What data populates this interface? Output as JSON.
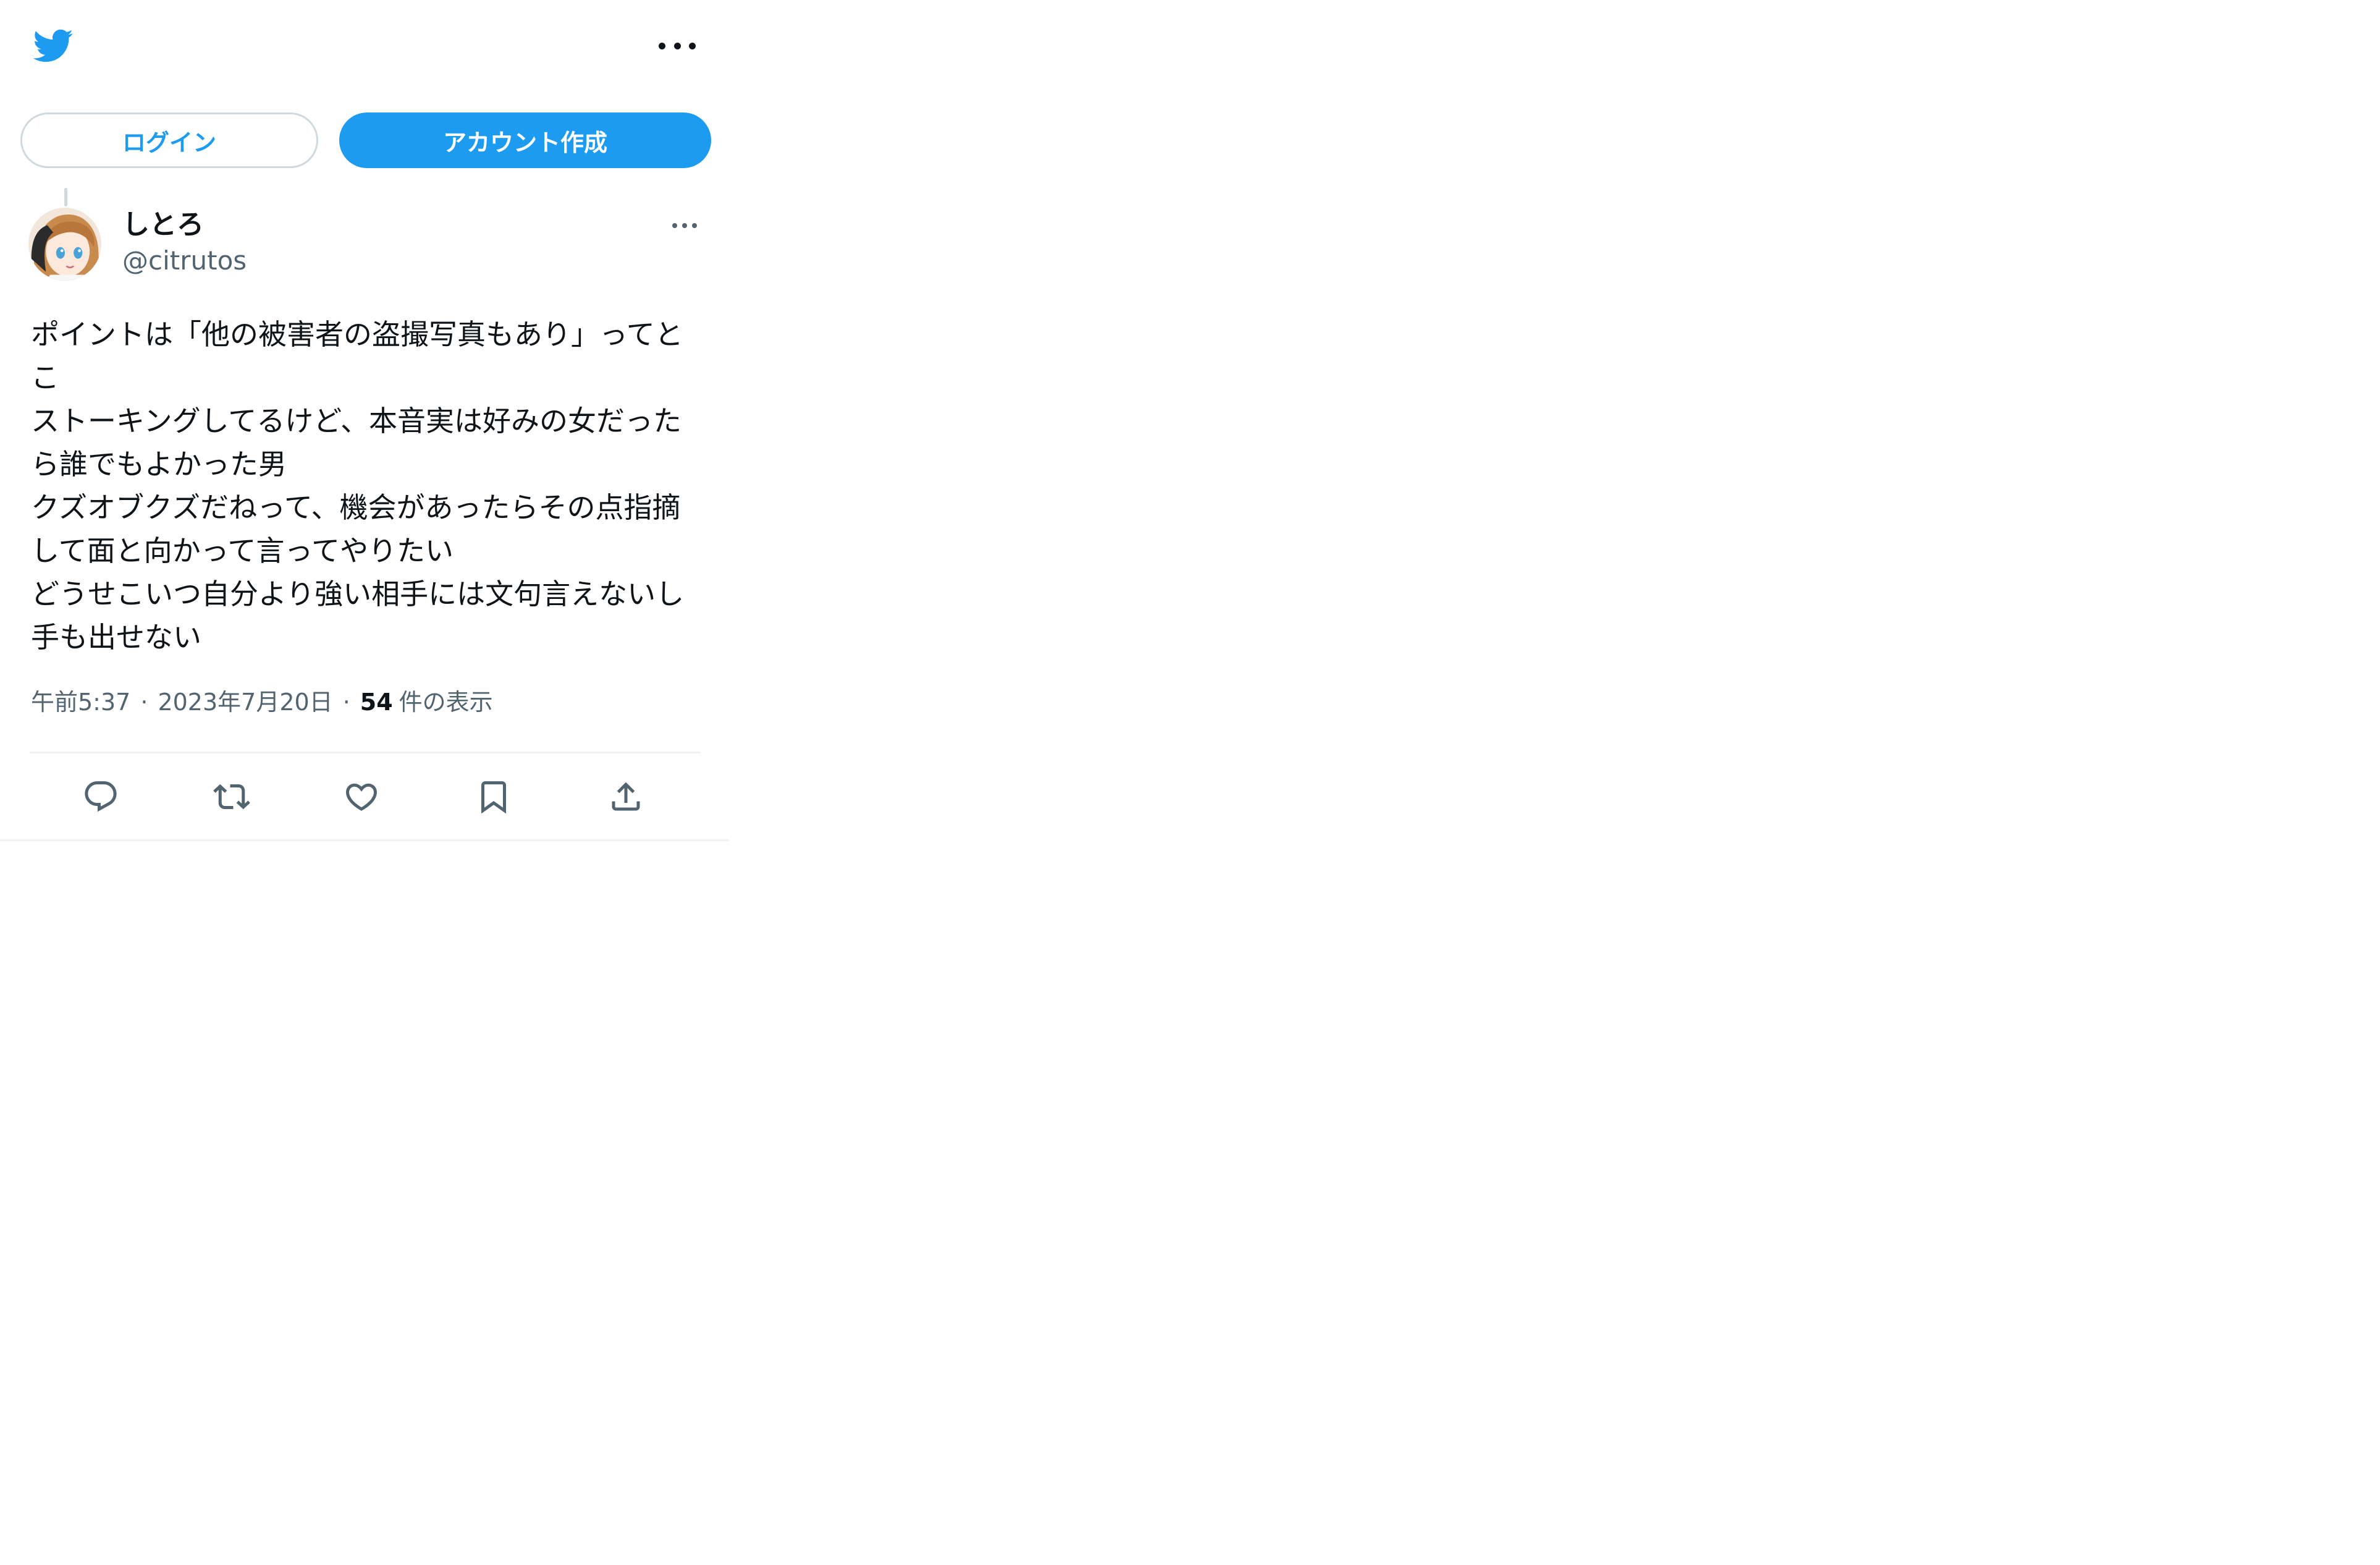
{
  "header": {
    "logo_icon": "twitter-bird-icon",
    "more_icon": "more-horizontal-icon"
  },
  "auth": {
    "login_label": "ログイン",
    "signup_label": "アカウント作成"
  },
  "tweet": {
    "author": {
      "name": "しとろ",
      "handle": "@citrutos",
      "avatar_icon": "avatar-anime-girl"
    },
    "text": "ポイントは「他の被害者の盗撮写真もあり」ってとこ\nストーキングしてるけど、本音実は好みの女だったら誰でもよかった男\nクズオブクズだねって、機会があったらその点指摘して面と向かって言ってやりたい\nどうせこいつ自分より強い相手には文句言えないし手も出せない",
    "time": "午前5:37",
    "separator": "·",
    "date": "2023年7月20日",
    "views_count": "54",
    "views_label": "件の表示"
  },
  "actions": [
    {
      "name": "reply",
      "icon": "reply-icon"
    },
    {
      "name": "retweet",
      "icon": "retweet-icon"
    },
    {
      "name": "like",
      "icon": "like-icon"
    },
    {
      "name": "bookmark",
      "icon": "bookmark-icon"
    },
    {
      "name": "share",
      "icon": "share-icon"
    }
  ],
  "colors": {
    "accent": "#1d9bf0",
    "text_primary": "#0f1419",
    "text_secondary": "#536471",
    "border": "#cfd9de"
  }
}
